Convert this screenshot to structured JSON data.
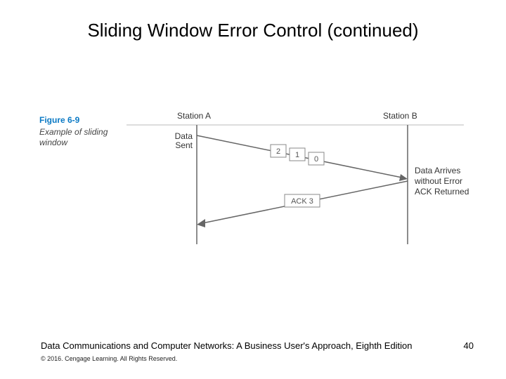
{
  "title": "Sliding Window Error Control (continued)",
  "figure": {
    "label": "Figure 6-9",
    "caption": "Example of sliding window"
  },
  "diagram": {
    "station_a": "Station A",
    "station_b": "Station B",
    "data_sent": "Data\nSent",
    "arrives": "Data Arrives without Error ACK Returned",
    "packets": {
      "p0": "0",
      "p1": "1",
      "p2": "2"
    },
    "ack_label": "ACK 3"
  },
  "footer": {
    "book": "Data Communications and Computer Networks: A Business User's Approach, Eighth Edition",
    "copyright": "© 2016. Cengage Learning. All Rights Reserved.",
    "page": "40"
  }
}
